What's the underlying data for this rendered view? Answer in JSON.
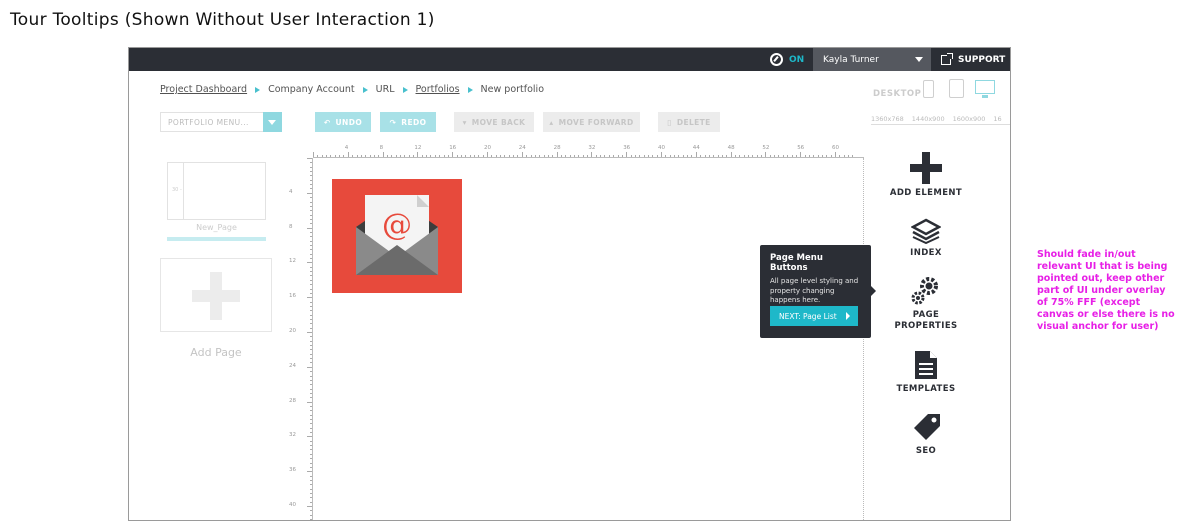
{
  "heading": "Tour Tooltips (Shown Without User Interaction 1)",
  "topbar": {
    "tour_status": "ON",
    "user_name": "Kayla Turner",
    "support_label": "SUPPORT"
  },
  "breadcrumb": {
    "items": [
      "Project Dashboard",
      "Company Account",
      "URL",
      "Portfolios",
      "New portfolio"
    ]
  },
  "devices": {
    "current_label": "DESKTOP",
    "resolutions": [
      "1360x768",
      "1440x900",
      "1600x900",
      "16"
    ]
  },
  "toolbar": {
    "portfolio_menu": "PORTFOLIO MENU...",
    "undo": "UNDO",
    "redo": "REDO",
    "move_back": "MOVE BACK",
    "move_forward": "MOVE FORWARD",
    "delete": "DELETE"
  },
  "pages": {
    "thumb_mark": "30 -",
    "page_name": "New_Page",
    "add_page": "Add Page"
  },
  "ruler": {
    "top": [
      "4",
      "8",
      "12",
      "16",
      "20",
      "24",
      "28",
      "32",
      "36",
      "40",
      "44",
      "48",
      "52",
      "56",
      "60"
    ],
    "left": [
      "4",
      "8",
      "12",
      "16",
      "20",
      "24",
      "28",
      "32",
      "36",
      "40"
    ]
  },
  "right_menu": {
    "add_element": "ADD ELEMENT",
    "index": "INDEX",
    "page_properties_1": "PAGE",
    "page_properties_2": "PROPERTIES",
    "templates": "TEMPLATES",
    "seo": "SEO"
  },
  "tooltip": {
    "title": "Page Menu Buttons",
    "body": "All page level styling and property changing happens here.",
    "next_label": "NEXT: Page List"
  },
  "annotation": "Should fade in/out relevant UI that is being pointed out, keep other part of UI under overlay of 75% FFF (except canvas or else there is no visual anchor for user)",
  "colors": {
    "topbar": "#2b2e35",
    "accent": "#1eb8c9",
    "email_tile": "#e74a3c",
    "annotation": "#e71fe6"
  }
}
